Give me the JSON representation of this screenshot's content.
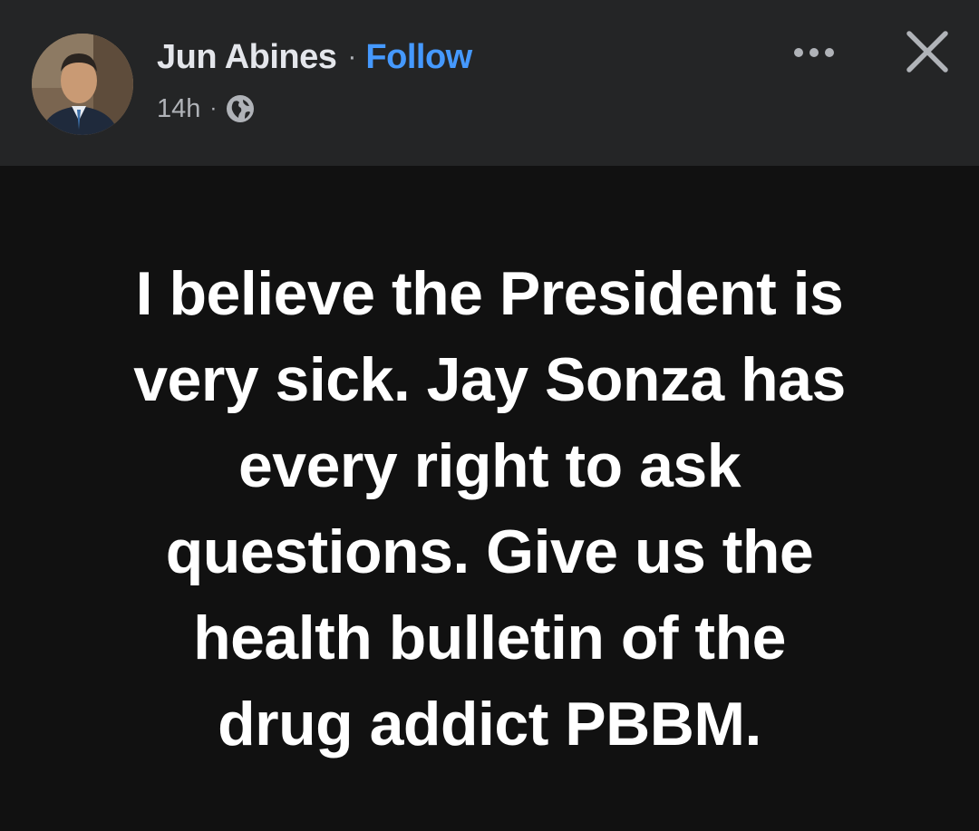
{
  "post": {
    "author_name": "Jun Abines",
    "separator": "·",
    "follow_label": "Follow",
    "timestamp": "14h",
    "audience_icon": "globe-icon",
    "more_icon": "more-options-icon",
    "close_icon": "close-icon",
    "lines": [
      "I believe the President is",
      "very sick. Jay Sonza has",
      "every right to ask",
      "questions. Give us the",
      "health bulletin of the",
      "drug addict PBBM."
    ]
  },
  "colors": {
    "header_bg": "#242526",
    "body_bg": "#111111",
    "follow_link": "#4599ff",
    "text_primary": "#e4e6eb",
    "text_secondary": "#b0b3b8",
    "post_text": "#ffffff"
  }
}
